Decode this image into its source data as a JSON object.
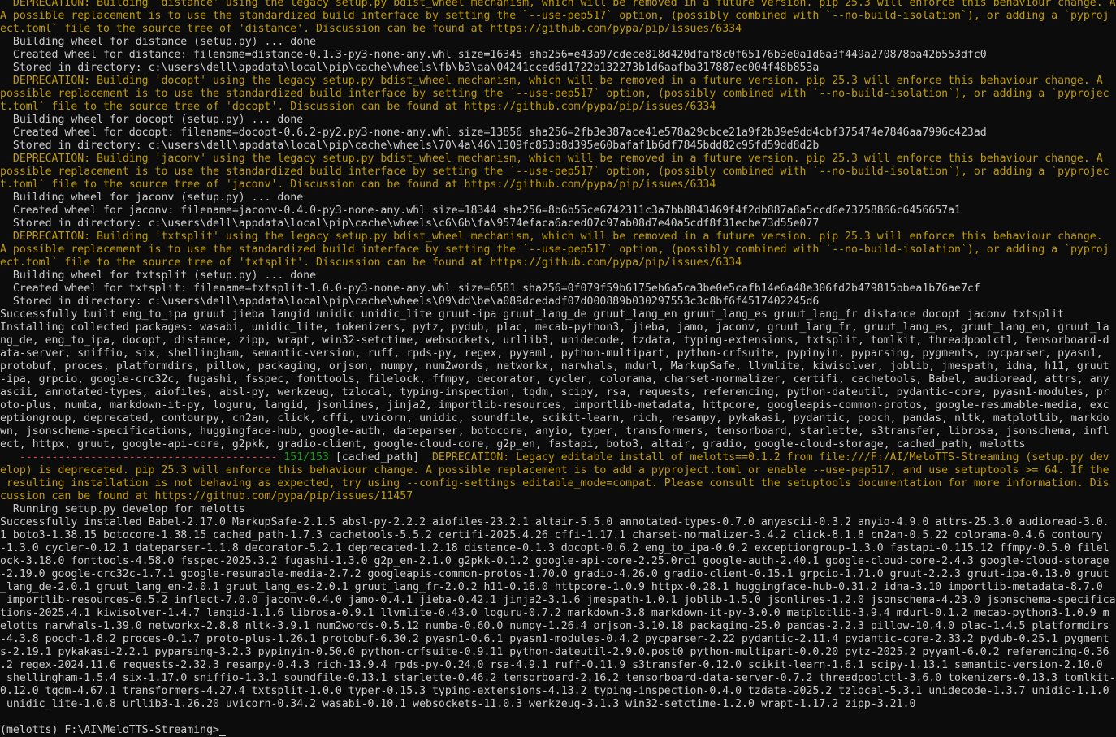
{
  "colors": {
    "background": "#0c0c0c",
    "default_text": "#cccccc",
    "warning_text": "#c19c00",
    "progress_bar": "#e74856",
    "progress_count": "#13a10e"
  },
  "lines": [
    {
      "style": "warn",
      "text": "  DEPRECATION: Building 'distance' using the legacy setup.py bdist_wheel mechanism, which will be removed in a future version. pip 25.3 will enforce this behaviour change. A"
    },
    {
      "style": "warn",
      "text": "A possible replacement is to use the standardized build interface by setting the `--use-pep517` option, (possibly combined with `--no-build-isolation`), or adding a `pyproj"
    },
    {
      "style": "warn",
      "text": "ect.toml` file to the source tree of 'distance'. Discussion can be found at https://github.com/pypa/pip/issues/6334"
    },
    {
      "style": "plain",
      "text": "  Building wheel for distance (setup.py) ... done"
    },
    {
      "style": "plain",
      "text": "  Created wheel for distance: filename=distance-0.1.3-py3-none-any.whl size=16345 sha256=e43a97cdece818d420dfaf8c0f65176b3e0a1d6a3f449a270878ba42b553dfc0"
    },
    {
      "style": "plain",
      "text": "  Stored in directory: c:\\users\\dell\\appdata\\local\\pip\\cache\\wheels\\fb\\b3\\aa\\04241cced6d1722b132273b1d6aafba317887ec004f48b853a"
    },
    {
      "style": "warn",
      "text": "  DEPRECATION: Building 'docopt' using the legacy setup.py bdist_wheel mechanism, which will be removed in a future version. pip 25.3 will enforce this behaviour change. A"
    },
    {
      "style": "warn",
      "text": "possible replacement is to use the standardized build interface by setting the `--use-pep517` option, (possibly combined with `--no-build-isolation`), or adding a `pyprojec"
    },
    {
      "style": "warn",
      "text": "t.toml` file to the source tree of 'docopt'. Discussion can be found at https://github.com/pypa/pip/issues/6334"
    },
    {
      "style": "plain",
      "text": "  Building wheel for docopt (setup.py) ... done"
    },
    {
      "style": "plain",
      "text": "  Created wheel for docopt: filename=docopt-0.6.2-py2.py3-none-any.whl size=13856 sha256=2fb3e387ace41e578a29cbce21a9f2b39e9dd4cbf375474e7846aa7996c423ad"
    },
    {
      "style": "plain",
      "text": "  Stored in directory: c:\\users\\dell\\appdata\\local\\pip\\cache\\wheels\\70\\4a\\46\\1309fc853b8d395e60bafaf1b6df7845bdd82c95fd59dd8d2b"
    },
    {
      "style": "warn",
      "text": "  DEPRECATION: Building 'jaconv' using the legacy setup.py bdist_wheel mechanism, which will be removed in a future version. pip 25.3 will enforce this behaviour change. A"
    },
    {
      "style": "warn",
      "text": "possible replacement is to use the standardized build interface by setting the `--use-pep517` option, (possibly combined with `--no-build-isolation`), or adding a `pyprojec"
    },
    {
      "style": "warn",
      "text": "t.toml` file to the source tree of 'jaconv'. Discussion can be found at https://github.com/pypa/pip/issues/6334"
    },
    {
      "style": "plain",
      "text": "  Building wheel for jaconv (setup.py) ... done"
    },
    {
      "style": "plain",
      "text": "  Created wheel for jaconv: filename=jaconv-0.4.0-py3-none-any.whl size=18344 sha256=8b6b55ce6742311c3a7bb8843469f4f2db887a8a5ccd6e73758866c6456657a1"
    },
    {
      "style": "plain",
      "text": "  Stored in directory: c:\\users\\dell\\appdata\\local\\pip\\cache\\wheels\\c6\\6b\\fa\\9574efaca6aced07c97ab08d7e40a5cdf8f31ecbe73d55e077"
    },
    {
      "style": "warn",
      "text": "  DEPRECATION: Building 'txtsplit' using the legacy setup.py bdist_wheel mechanism, which will be removed in a future version. pip 25.3 will enforce this behaviour change."
    },
    {
      "style": "warn",
      "text": "A possible replacement is to use the standardized build interface by setting the `--use-pep517` option, (possibly combined with `--no-build-isolation`), or adding a `pyproj"
    },
    {
      "style": "warn",
      "text": "ect.toml` file to the source tree of 'txtsplit'. Discussion can be found at https://github.com/pypa/pip/issues/6334"
    },
    {
      "style": "plain",
      "text": "  Building wheel for txtsplit (setup.py) ... done"
    },
    {
      "style": "plain",
      "text": "  Created wheel for txtsplit: filename=txtsplit-1.0.0-py3-none-any.whl size=6581 sha256=0f079f59b6175eb6a5ca3be0e5cafb14e6a48e306fd2b479815bbea1b76ae7cf"
    },
    {
      "style": "plain",
      "text": "  Stored in directory: c:\\users\\dell\\appdata\\local\\pip\\cache\\wheels\\09\\dd\\be\\a089dcedadf07d000889b030297553c3c8bf6f4517402245d6"
    },
    {
      "style": "plain",
      "text": "Successfully built eng_to_ipa gruut jieba langid unidic unidic_lite gruut-ipa gruut_lang_de gruut_lang_en gruut_lang_es gruut_lang_fr distance docopt jaconv txtsplit"
    },
    {
      "style": "plain",
      "text": "Installing collected packages: wasabi, unidic_lite, tokenizers, pytz, pydub, plac, mecab-python3, jieba, jamo, jaconv, gruut_lang_fr, gruut_lang_es, gruut_lang_en, gruut_la"
    },
    {
      "style": "plain",
      "text": "ng_de, eng_to_ipa, docopt, distance, zipp, wrapt, win32-setctime, websockets, urllib3, unidecode, tzdata, typing-extensions, txtsplit, tomlkit, threadpoolctl, tensorboard-d"
    },
    {
      "style": "plain",
      "text": "ata-server, sniffio, six, shellingham, semantic-version, ruff, rpds-py, regex, pyyaml, python-multipart, python-crfsuite, pypinyin, pyparsing, pygments, pycparser, pyasn1,"
    },
    {
      "style": "plain",
      "text": "protobuf, proces, platformdirs, pillow, packaging, orjson, numpy, num2words, networkx, narwhals, mdurl, MarkupSafe, llvmlite, kiwisolver, joblib, jmespath, idna, h11, gruut"
    },
    {
      "style": "plain",
      "text": "-ipa, grpcio, google-crc32c, fugashi, fsspec, fonttools, filelock, ffmpy, decorator, cycler, colorama, charset-normalizer, certifi, cachetools, Babel, audioread, attrs, any"
    },
    {
      "style": "plain",
      "text": "ascii, annotated-types, aiofiles, absl-py, werkzeug, tzlocal, typing-inspection, tqdm, scipy, rsa, requests, referencing, python-dateutil, pydantic-core, pyasn1-modules, pr"
    },
    {
      "style": "plain",
      "text": "oto-plus, numba, markdown-it-py, loguru, langid, jsonlines, jinja2, importlib-resources, importlib-metadata, httpcore, googleapis-common-protos, google-resumable-media, exc"
    },
    {
      "style": "plain",
      "text": "eptiongroup, deprecated, contourpy, cn2an, click, cffi, uvicorn, unidic, soundfile, scikit-learn, rich, resampy, pykakasi, pydantic, pooch, pandas, nltk, matplotlib, markdo"
    },
    {
      "style": "plain",
      "text": "wn, jsonschema-specifications, huggingface-hub, google-auth, dateparser, botocore, anyio, typer, transformers, tensorboard, starlette, s3transfer, librosa, jsonschema, infl"
    },
    {
      "style": "plain",
      "text": "ect, httpx, gruut, google-api-core, g2pkk, gradio-client, google-cloud-core, g2p_en, fastapi, boto3, altair, gradio, google-cloud-storage, cached_path, melotts"
    },
    {
      "style": "progress",
      "bar": "   ----------------------------------------",
      "count": "151/153",
      "tag": "[cached_path]",
      "msg": "  DEPRECATION: Legacy editable install of melotts==0.1.2 from file:///F:/AI/MeloTTS-Streaming (setup.py dev"
    },
    {
      "style": "warn",
      "text": "elop) is deprecated. pip 25.3 will enforce this behaviour change. A possible replacement is to add a pyproject.toml or enable --use-pep517, and use setuptools >= 64. If the"
    },
    {
      "style": "warn",
      "text": " resulting installation is not behaving as expected, try using --config-settings editable_mode=compat. Please consult the setuptools documentation for more information. Dis"
    },
    {
      "style": "warn",
      "text": "cussion can be found at https://github.com/pypa/pip/issues/11457"
    },
    {
      "style": "plain",
      "text": "  Running setup.py develop for melotts"
    },
    {
      "style": "plain",
      "text": "Successfully installed Babel-2.17.0 MarkupSafe-2.1.5 absl-py-2.2.2 aiofiles-23.2.1 altair-5.5.0 annotated-types-0.7.0 anyascii-0.3.2 anyio-4.9.0 attrs-25.3.0 audioread-3.0."
    },
    {
      "style": "plain",
      "text": "1 boto3-1.38.15 botocore-1.38.15 cached_path-1.7.3 cachetools-5.5.2 certifi-2025.4.26 cffi-1.17.1 charset-normalizer-3.4.2 click-8.1.8 cn2an-0.5.22 colorama-0.4.6 contoury"
    },
    {
      "style": "plain",
      "text": "-1.3.0 cycler-0.12.1 dateparser-1.1.8 decorator-5.2.1 deprecated-1.2.18 distance-0.1.3 docopt-0.6.2 eng_to_ipa-0.0.2 exceptiongroup-1.3.0 fastapi-0.115.12 ffmpy-0.5.0 filel"
    },
    {
      "style": "plain",
      "text": "ock-3.18.0 fonttools-4.58.0 fsspec-2025.3.2 fugashi-1.3.0 g2p_en-2.1.0 g2pkk-0.1.2 google-api-core-2.25.0rc1 google-auth-2.40.1 google-cloud-core-2.4.3 google-cloud-storage"
    },
    {
      "style": "plain",
      "text": "-2.19.0 google-crc32c-1.7.1 google-resumable-media-2.7.2 googleapis-common-protos-1.70.0 gradio-4.26.0 gradio-client-0.15.1 grpcio-1.71.0 gruut-2.2.3 gruut-ipa-0.13.0 gruut"
    },
    {
      "style": "plain",
      "text": "_lang_de-2.0.1 gruut_lang_en-2.0.1 gruut_lang_es-2.0.1 gruut_lang_fr-2.0.2 h11-0.16.0 httpcore-1.0.9 httpx-0.28.1 huggingface-hub-0.31.2 idna-3.10 importlib-metadata-8.7.0"
    },
    {
      "style": "plain",
      "text": " importlib-resources-6.5.2 inflect-7.0.0 jaconv-0.4.0 jamo-0.4.1 jieba-0.42.1 jinja2-3.1.6 jmespath-1.0.1 joblib-1.5.0 jsonlines-1.2.0 jsonschema-4.23.0 jsonschema-specifica"
    },
    {
      "style": "plain",
      "text": "tions-2025.4.1 kiwisolver-1.4.7 langid-1.1.6 librosa-0.9.1 llvmlite-0.43.0 loguru-0.7.2 markdown-3.8 markdown-it-py-3.0.0 matplotlib-3.9.4 mdurl-0.1.2 mecab-python3-1.0.9 m"
    },
    {
      "style": "plain",
      "text": "elotts narwhals-1.39.0 networkx-2.8.8 nltk-3.9.1 num2words-0.5.12 numba-0.60.0 numpy-1.26.4 orjson-3.10.18 packaging-25.0 pandas-2.2.3 pillow-10.4.0 plac-1.4.5 platformdirs"
    },
    {
      "style": "plain",
      "text": "-4.3.8 pooch-1.8.2 proces-0.1.7 proto-plus-1.26.1 protobuf-6.30.2 pyasn1-0.6.1 pyasn1-modules-0.4.2 pycparser-2.22 pydantic-2.11.4 pydantic-core-2.33.2 pydub-0.25.1 pygment"
    },
    {
      "style": "plain",
      "text": "s-2.19.1 pykakasi-2.2.1 pyparsing-3.2.3 pypinyin-0.50.0 python-crfsuite-0.9.11 python-dateutil-2.9.0.post0 python-multipart-0.0.20 pytz-2025.2 pyyaml-6.0.2 referencing-0.36"
    },
    {
      "style": "plain",
      "text": ".2 regex-2024.11.6 requests-2.32.3 resampy-0.4.3 rich-13.9.4 rpds-py-0.24.0 rsa-4.9.1 ruff-0.11.9 s3transfer-0.12.0 scikit-learn-1.6.1 scipy-1.13.1 semantic-version-2.10.0"
    },
    {
      "style": "plain",
      "text": " shellingham-1.5.4 six-1.17.0 sniffio-1.3.1 soundfile-0.13.1 starlette-0.46.2 tensorboard-2.16.2 tensorboard-data-server-0.7.2 threadpoolctl-3.6.0 tokenizers-0.13.3 tomlkit-"
    },
    {
      "style": "plain",
      "text": "0.12.0 tqdm-4.67.1 transformers-4.27.4 txtsplit-1.0.0 typer-0.15.3 typing-extensions-4.13.2 typing-inspection-0.4.0 tzdata-2025.2 tzlocal-5.3.1 unidecode-1.3.7 unidic-1.1.0"
    },
    {
      "style": "plain",
      "text": " unidic_lite-1.0.8 urllib3-1.26.20 uvicorn-0.34.2 wasabi-0.10.1 websockets-11.0.3 werkzeug-3.1.3 win32-setctime-1.2.0 wrapt-1.17.2 zipp-3.21.0"
    },
    {
      "style": "blank",
      "text": ""
    },
    {
      "style": "prompt",
      "text": "(melotts) F:\\AI\\MeloTTS-Streaming>"
    }
  ]
}
